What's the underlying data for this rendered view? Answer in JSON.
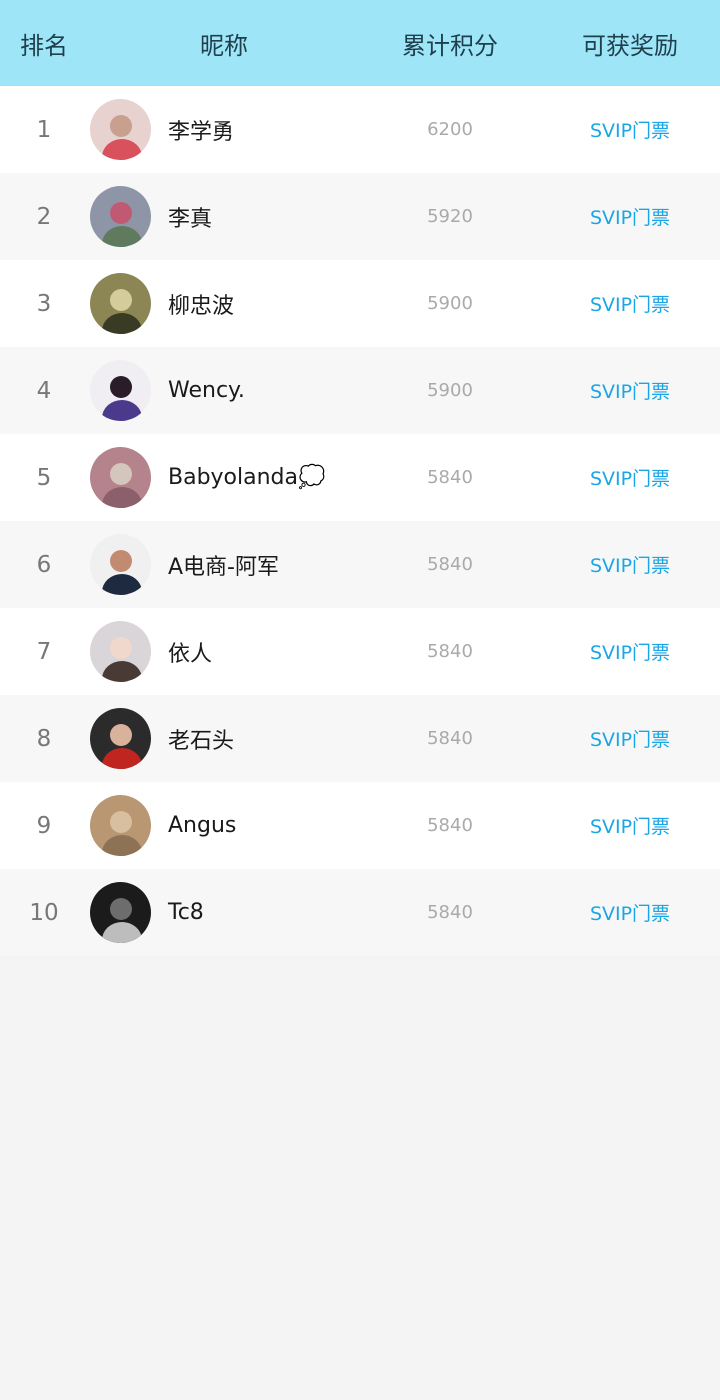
{
  "header": {
    "rank": "排名",
    "nickname": "昵称",
    "score": "累计积分",
    "reward": "可获奖励"
  },
  "rows": [
    {
      "rank": "1",
      "nickname": "李学勇",
      "score": "6200",
      "reward": "SVIP门票",
      "avatar_colors": [
        "#e8d2cf",
        "#d9515c",
        "#c7a08e"
      ]
    },
    {
      "rank": "2",
      "nickname": "李真",
      "score": "5920",
      "reward": "SVIP门票",
      "avatar_colors": [
        "#8e95a6",
        "#5f7a5c",
        "#c05a74"
      ]
    },
    {
      "rank": "3",
      "nickname": "柳忠波",
      "score": "5900",
      "reward": "SVIP门票",
      "avatar_colors": [
        "#8c8655",
        "#3a3b25",
        "#d4cc9a"
      ]
    },
    {
      "rank": "4",
      "nickname": "Wency.",
      "score": "5900",
      "reward": "SVIP门票",
      "avatar_colors": [
        "#f1eef3",
        "#4b3a8c",
        "#2a1c28"
      ]
    },
    {
      "rank": "5",
      "nickname": "Babyolanda💭",
      "score": "5840",
      "reward": "SVIP门票",
      "avatar_colors": [
        "#b5838b",
        "#8b5f6c",
        "#d4c5bd"
      ]
    },
    {
      "rank": "6",
      "nickname": "A电商-阿军",
      "score": "5840",
      "reward": "SVIP门票",
      "avatar_colors": [
        "#f0f0f0",
        "#1e2a40",
        "#c38a72"
      ]
    },
    {
      "rank": "7",
      "nickname": "依人",
      "score": "5840",
      "reward": "SVIP门票",
      "avatar_colors": [
        "#d9d5d8",
        "#4a3a36",
        "#f1d8cc"
      ]
    },
    {
      "rank": "8",
      "nickname": "老石头",
      "score": "5840",
      "reward": "SVIP门票",
      "avatar_colors": [
        "#2b2b2b",
        "#c0261f",
        "#d9b29c"
      ]
    },
    {
      "rank": "9",
      "nickname": "Angus",
      "score": "5840",
      "reward": "SVIP门票",
      "avatar_colors": [
        "#b89772",
        "#8e7256",
        "#d8bfa0"
      ]
    },
    {
      "rank": "10",
      "nickname": "Tc8",
      "score": "5840",
      "reward": "SVIP门票",
      "avatar_colors": [
        "#1b1b1b",
        "#bdbdbd",
        "#6d6d6d"
      ]
    }
  ]
}
